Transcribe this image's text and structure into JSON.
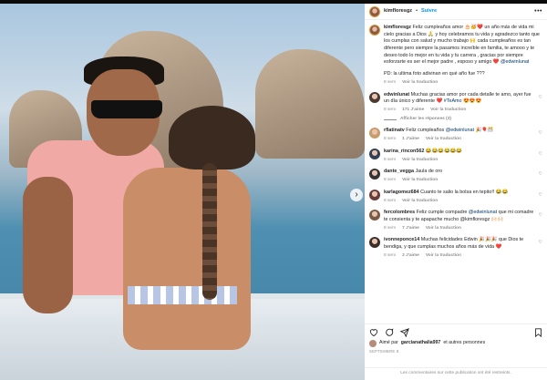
{
  "post": {
    "nav_next": "›"
  },
  "header": {
    "username": "kimfloresgz",
    "separator": "•",
    "follow": "Suivre",
    "more": "•••"
  },
  "caption": {
    "username": "kimfloresgz",
    "text": "Feliz cumpleaños amor 🎂🥳❤️ un año más de vida mi cielo gracias a Dios 🙏 y hoy celebramos tu vida y agradezco tanto que los cumplas con salud y mucho trabajo 🙌 cada cumpleaños es tan diferente pero siempre la pasamos increíble en familia, te amooo y te deseo todo lo mejor en tu vida y tu carrera , gracias por siempre esforzarte es ser el mejor padre , esposo y amigo ❤️",
    "mention": "@edwinlunat",
    "ps": "PD: la ultima foto adivinan en qué año fue ???",
    "time": "8 sem",
    "translate": "Voir la traduction"
  },
  "comments": [
    {
      "user": "edwinlunat",
      "text": "Muchas gracias amor por cada detalle te amo, ayer fue un día único y diferente ❤️",
      "mention": "#TeAmo",
      "tail": "😍😍😍",
      "time": "8 sem",
      "likes": "171 J'aime",
      "translate": "Voir la traduction",
      "color": "#4b3a30"
    },
    {
      "user": "rflatinatv",
      "text": "Feliz cumpleaños",
      "mention": "@edwinlunat",
      "tail": "🎉🎈🎊",
      "time": "8 sem",
      "likes": "1 J'aime",
      "translate": "Voir la traduction",
      "color": "#c79b6a"
    },
    {
      "user": "karina_rincon562",
      "text": "😂😂😂😂😂😂",
      "mention": "",
      "tail": "",
      "time": "8 sem",
      "likes": "",
      "translate": "Voir la traduction",
      "color": "#2f3f55"
    },
    {
      "user": "dante_vegga",
      "text": "Jaula de oro",
      "mention": "",
      "tail": "",
      "time": "8 sem",
      "likes": "",
      "translate": "Voir la traduction",
      "color": "#333"
    },
    {
      "user": "karlagomez684",
      "text": "Cuanto te salio la bolsa en tepito!! 😂😂",
      "mention": "",
      "tail": "",
      "time": "8 sem",
      "likes": "",
      "translate": "Voir la traduction",
      "color": "#6a3b3b"
    },
    {
      "user": "fercolombres",
      "text": "Feliz cumple compadre",
      "mention": "@edwinlunat",
      "tail": "que mi comadre te consienta y te apapache mucho @kimfloresgz 🙌🏻🙌🏻",
      "time": "8 sem",
      "likes": "7 J'aime",
      "translate": "Voir la traduction",
      "color": "#7b5a43"
    },
    {
      "user": "ivonneponce14",
      "text": "Muchas felicidades Edwin 🎉🎉🎉 que Dios te bendiga, y que cumplas muchos años más de vida ❤️",
      "mention": "",
      "tail": "",
      "time": "8 sem",
      "likes": "2 J'aime",
      "translate": "Voir la traduction",
      "color": "#3c2e28"
    }
  ],
  "replies": {
    "label": "Afficher les réponses (3)"
  },
  "actions": {
    "like_icon": "heart-icon",
    "comment_icon": "comment-icon",
    "share_icon": "share-icon",
    "save_icon": "bookmark-icon"
  },
  "likes": {
    "prefix": "Aimé par",
    "user": "garcianathalia997",
    "suffix": "et autres personnes"
  },
  "date": "SEPTEMBRE 8",
  "footer": "Les commentaires sur cette publication ont été restreints.",
  "colors": {
    "link": "#0095f6",
    "mention": "#00376b",
    "muted": "#8e8e8e"
  }
}
